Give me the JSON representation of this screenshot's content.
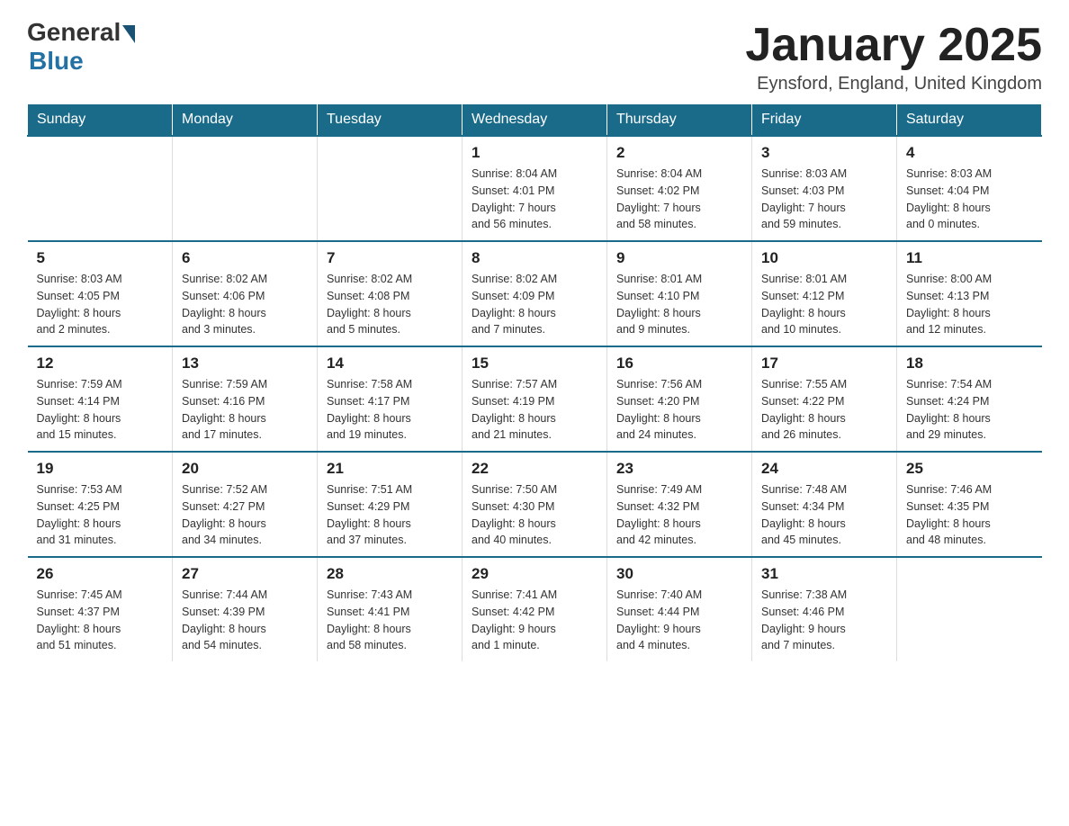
{
  "header": {
    "logo": {
      "general": "General",
      "blue": "Blue",
      "arrow_color": "#1a5276"
    },
    "title": "January 2025",
    "location": "Eynsford, England, United Kingdom"
  },
  "calendar": {
    "days_of_week": [
      "Sunday",
      "Monday",
      "Tuesday",
      "Wednesday",
      "Thursday",
      "Friday",
      "Saturday"
    ],
    "header_bg": "#1a6b8a",
    "weeks": [
      [
        {
          "day": "",
          "info": ""
        },
        {
          "day": "",
          "info": ""
        },
        {
          "day": "",
          "info": ""
        },
        {
          "day": "1",
          "info": "Sunrise: 8:04 AM\nSunset: 4:01 PM\nDaylight: 7 hours\nand 56 minutes."
        },
        {
          "day": "2",
          "info": "Sunrise: 8:04 AM\nSunset: 4:02 PM\nDaylight: 7 hours\nand 58 minutes."
        },
        {
          "day": "3",
          "info": "Sunrise: 8:03 AM\nSunset: 4:03 PM\nDaylight: 7 hours\nand 59 minutes."
        },
        {
          "day": "4",
          "info": "Sunrise: 8:03 AM\nSunset: 4:04 PM\nDaylight: 8 hours\nand 0 minutes."
        }
      ],
      [
        {
          "day": "5",
          "info": "Sunrise: 8:03 AM\nSunset: 4:05 PM\nDaylight: 8 hours\nand 2 minutes."
        },
        {
          "day": "6",
          "info": "Sunrise: 8:02 AM\nSunset: 4:06 PM\nDaylight: 8 hours\nand 3 minutes."
        },
        {
          "day": "7",
          "info": "Sunrise: 8:02 AM\nSunset: 4:08 PM\nDaylight: 8 hours\nand 5 minutes."
        },
        {
          "day": "8",
          "info": "Sunrise: 8:02 AM\nSunset: 4:09 PM\nDaylight: 8 hours\nand 7 minutes."
        },
        {
          "day": "9",
          "info": "Sunrise: 8:01 AM\nSunset: 4:10 PM\nDaylight: 8 hours\nand 9 minutes."
        },
        {
          "day": "10",
          "info": "Sunrise: 8:01 AM\nSunset: 4:12 PM\nDaylight: 8 hours\nand 10 minutes."
        },
        {
          "day": "11",
          "info": "Sunrise: 8:00 AM\nSunset: 4:13 PM\nDaylight: 8 hours\nand 12 minutes."
        }
      ],
      [
        {
          "day": "12",
          "info": "Sunrise: 7:59 AM\nSunset: 4:14 PM\nDaylight: 8 hours\nand 15 minutes."
        },
        {
          "day": "13",
          "info": "Sunrise: 7:59 AM\nSunset: 4:16 PM\nDaylight: 8 hours\nand 17 minutes."
        },
        {
          "day": "14",
          "info": "Sunrise: 7:58 AM\nSunset: 4:17 PM\nDaylight: 8 hours\nand 19 minutes."
        },
        {
          "day": "15",
          "info": "Sunrise: 7:57 AM\nSunset: 4:19 PM\nDaylight: 8 hours\nand 21 minutes."
        },
        {
          "day": "16",
          "info": "Sunrise: 7:56 AM\nSunset: 4:20 PM\nDaylight: 8 hours\nand 24 minutes."
        },
        {
          "day": "17",
          "info": "Sunrise: 7:55 AM\nSunset: 4:22 PM\nDaylight: 8 hours\nand 26 minutes."
        },
        {
          "day": "18",
          "info": "Sunrise: 7:54 AM\nSunset: 4:24 PM\nDaylight: 8 hours\nand 29 minutes."
        }
      ],
      [
        {
          "day": "19",
          "info": "Sunrise: 7:53 AM\nSunset: 4:25 PM\nDaylight: 8 hours\nand 31 minutes."
        },
        {
          "day": "20",
          "info": "Sunrise: 7:52 AM\nSunset: 4:27 PM\nDaylight: 8 hours\nand 34 minutes."
        },
        {
          "day": "21",
          "info": "Sunrise: 7:51 AM\nSunset: 4:29 PM\nDaylight: 8 hours\nand 37 minutes."
        },
        {
          "day": "22",
          "info": "Sunrise: 7:50 AM\nSunset: 4:30 PM\nDaylight: 8 hours\nand 40 minutes."
        },
        {
          "day": "23",
          "info": "Sunrise: 7:49 AM\nSunset: 4:32 PM\nDaylight: 8 hours\nand 42 minutes."
        },
        {
          "day": "24",
          "info": "Sunrise: 7:48 AM\nSunset: 4:34 PM\nDaylight: 8 hours\nand 45 minutes."
        },
        {
          "day": "25",
          "info": "Sunrise: 7:46 AM\nSunset: 4:35 PM\nDaylight: 8 hours\nand 48 minutes."
        }
      ],
      [
        {
          "day": "26",
          "info": "Sunrise: 7:45 AM\nSunset: 4:37 PM\nDaylight: 8 hours\nand 51 minutes."
        },
        {
          "day": "27",
          "info": "Sunrise: 7:44 AM\nSunset: 4:39 PM\nDaylight: 8 hours\nand 54 minutes."
        },
        {
          "day": "28",
          "info": "Sunrise: 7:43 AM\nSunset: 4:41 PM\nDaylight: 8 hours\nand 58 minutes."
        },
        {
          "day": "29",
          "info": "Sunrise: 7:41 AM\nSunset: 4:42 PM\nDaylight: 9 hours\nand 1 minute."
        },
        {
          "day": "30",
          "info": "Sunrise: 7:40 AM\nSunset: 4:44 PM\nDaylight: 9 hours\nand 4 minutes."
        },
        {
          "day": "31",
          "info": "Sunrise: 7:38 AM\nSunset: 4:46 PM\nDaylight: 9 hours\nand 7 minutes."
        },
        {
          "day": "",
          "info": ""
        }
      ]
    ]
  }
}
